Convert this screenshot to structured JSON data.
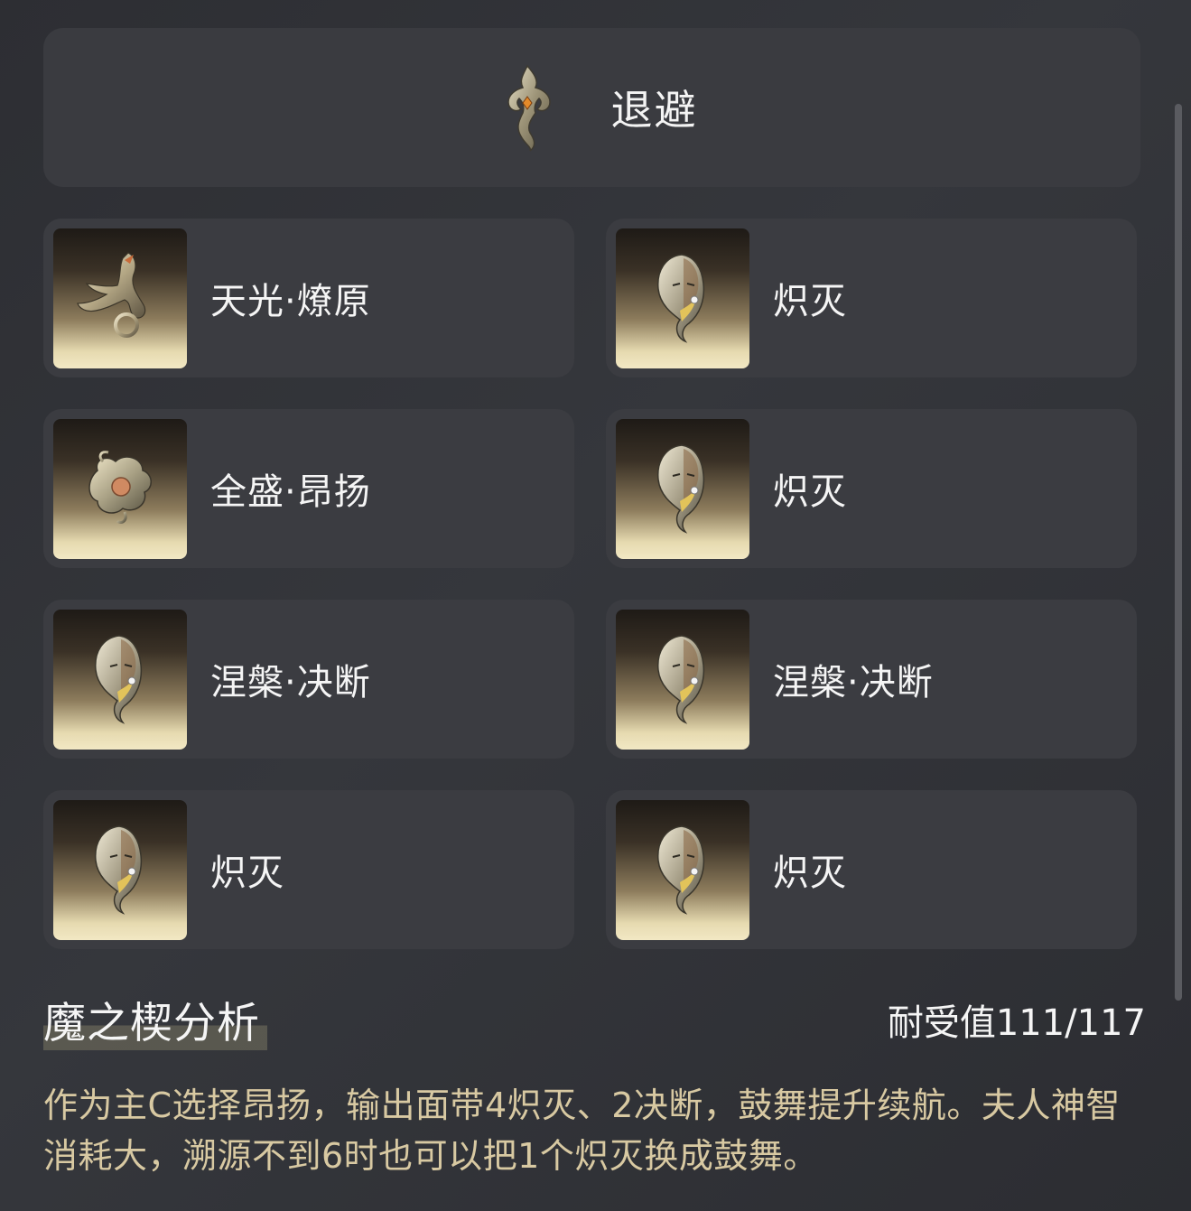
{
  "header": {
    "title": "退避",
    "icon": "serpent-emblem-icon"
  },
  "slots": [
    {
      "label": "天光·燎原",
      "icon": "phoenix-brooch-icon"
    },
    {
      "label": "炽灭",
      "icon": "mask-brooch-icon"
    },
    {
      "label": "全盛·昂扬",
      "icon": "dragon-brooch-icon"
    },
    {
      "label": "炽灭",
      "icon": "mask-brooch-icon"
    },
    {
      "label": "涅槃·决断",
      "icon": "mask-brooch-icon"
    },
    {
      "label": "涅槃·决断",
      "icon": "mask-brooch-icon"
    },
    {
      "label": "炽灭",
      "icon": "mask-brooch-icon"
    },
    {
      "label": "炽灭",
      "icon": "mask-brooch-icon"
    }
  ],
  "analysis": {
    "title": "魔之楔分析",
    "score": "耐受值111/117",
    "text": "作为主C选择昂扬，输出面带4炽灭、2决断，鼓舞提升续航。夫人神智消耗大，溯源不到6时也可以把1个炽灭换成鼓舞。"
  },
  "colors": {
    "accent_text": "#d8c9a2",
    "card_bg": "#3b3c41",
    "page_bg": "#303136"
  }
}
